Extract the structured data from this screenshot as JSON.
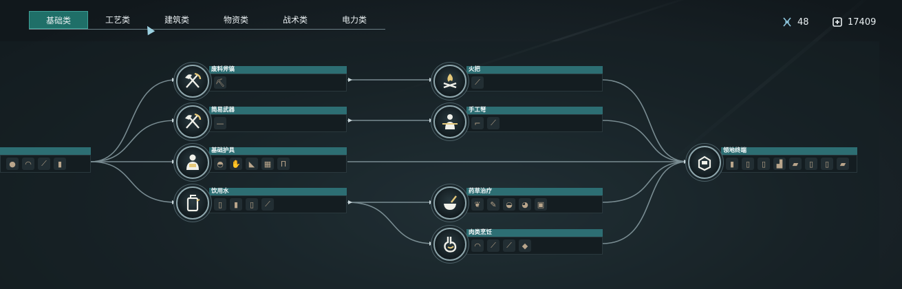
{
  "tabs": [
    {
      "label": "基础类",
      "active": true
    },
    {
      "label": "工艺类",
      "active": false
    },
    {
      "label": "建筑类",
      "active": false
    },
    {
      "label": "物资类",
      "active": false
    },
    {
      "label": "战术类",
      "active": false
    },
    {
      "label": "电力类",
      "active": false
    }
  ],
  "resources": {
    "points": "48",
    "currency": "17409"
  },
  "root": {
    "label": "",
    "items": [
      "stone-icon",
      "bone-icon",
      "stick-icon",
      "cloth-icon"
    ]
  },
  "nodes": {
    "scrap_tool": {
      "label": "废料斧镐",
      "icon": "axe-pickaxe-icon",
      "items": [
        "pickaxe-icon"
      ]
    },
    "simple_weapon": {
      "label": "简易武器",
      "icon": "axe-pickaxe-icon",
      "items": [
        "club-icon"
      ]
    },
    "basic_armor": {
      "label": "基础护具",
      "icon": "armored-person-icon",
      "items": [
        "helmet-icon",
        "gloves-icon",
        "boots-icon",
        "vest-icon",
        "pants-icon"
      ]
    },
    "drinking_water": {
      "label": "饮用水",
      "icon": "jerrycan-icon",
      "items": [
        "bottle-icon",
        "canteen-icon",
        "flask-icon",
        "ladle-icon"
      ]
    },
    "torch": {
      "label": "火把",
      "icon": "campfire-icon",
      "items": [
        "torch-icon"
      ]
    },
    "handmade_crossbow": {
      "label": "手工弩",
      "icon": "crossbow-person-icon",
      "items": [
        "pistol-icon",
        "crossbow-icon"
      ]
    },
    "herbal_treatment": {
      "label": "药草治疗",
      "icon": "mortar-icon",
      "items": [
        "herb-icon",
        "bandage-icon",
        "salve-icon",
        "pouch-icon",
        "kit-icon"
      ]
    },
    "meat_cooking": {
      "label": "肉类烹饪",
      "icon": "stomach-icon",
      "items": [
        "meat-icon",
        "skewer-icon",
        "sausage-icon",
        "steak-icon"
      ]
    },
    "territory_terminal": {
      "label": "领地终端",
      "icon": "terminal-icon",
      "items": [
        "wall-icon",
        "door-icon",
        "door2-icon",
        "stairs-icon",
        "roof-icon",
        "floor-icon",
        "foundation-icon",
        "window-icon"
      ]
    }
  }
}
